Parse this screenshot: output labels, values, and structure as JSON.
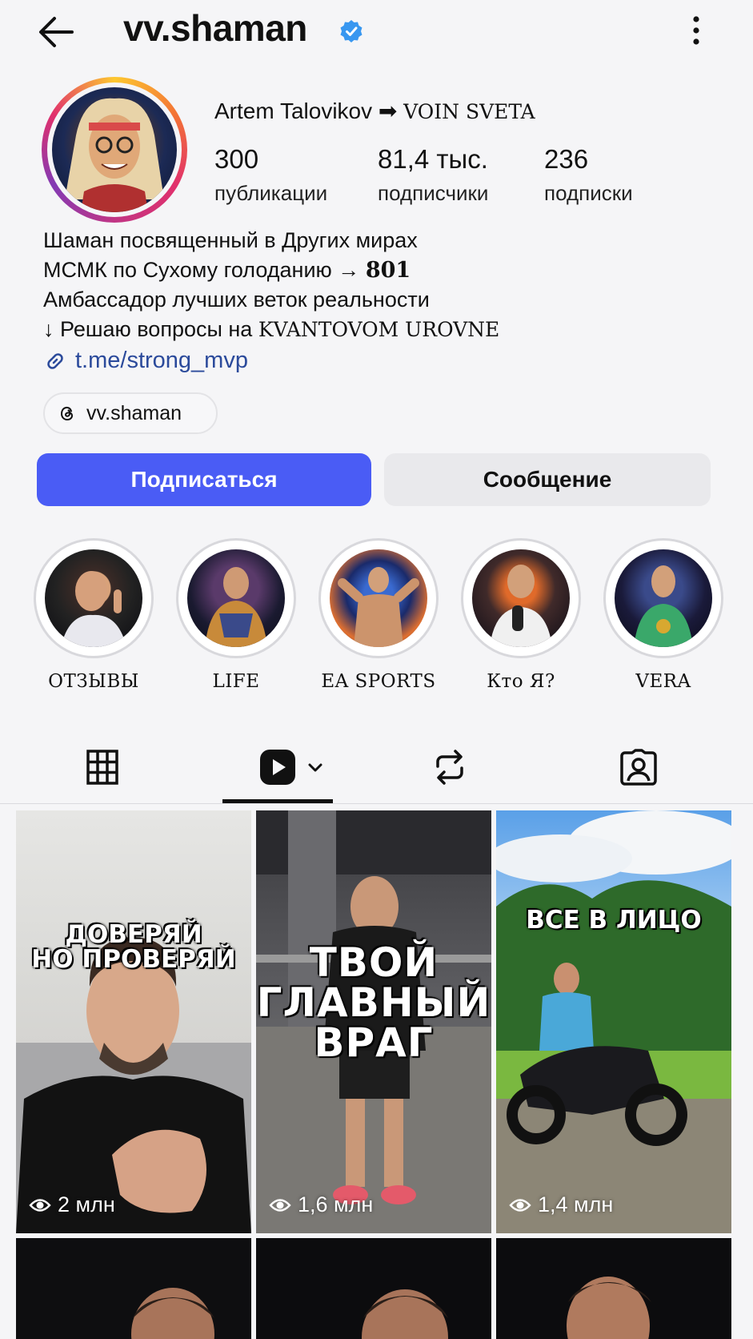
{
  "header": {
    "username": "vv.shaman",
    "back_icon": "arrow-left-icon",
    "more_icon": "more-vertical-icon",
    "verified_icon": "verified-badge-icon"
  },
  "profile": {
    "display_name_plain": "Artem Talovikov ➡ ",
    "display_name_styled": "VOIN SVETA",
    "stats": [
      {
        "value": "300",
        "label": "публикации"
      },
      {
        "value": "81,4 тыс.",
        "label": "подписчики"
      },
      {
        "value": "236",
        "label": "подписки"
      }
    ],
    "bio": {
      "line1": "Шаман посвященный в Других мирах",
      "line2_text": "МСМК по Сухому голоданию → ",
      "line2_num": "801",
      "line3": "Амбассадор лучших веток реальности",
      "line4_text": "↓ Решаю вопросы на ",
      "line4_styled": "KVANTOVOM UROVNE"
    },
    "link": "t.me/strong_mvp",
    "threads_handle": "vv.shaman"
  },
  "actions": {
    "follow": "Подписаться",
    "message": "Сообщение"
  },
  "highlights": [
    {
      "label": "ОТЗЫВЫ"
    },
    {
      "label": "LIFE"
    },
    {
      "label": "EA SPORTS"
    },
    {
      "label": "Кто Я?"
    },
    {
      "label": "VERA"
    }
  ],
  "tabs": {
    "grid_icon": "grid-icon",
    "reels_icon": "reels-icon",
    "reposts_icon": "repost-icon",
    "tagged_icon": "tagged-person-icon",
    "active": "reels"
  },
  "reels": [
    {
      "caption": "ДОВЕРЯЙ\nНО ПРОВЕРЯЙ",
      "views": "2 млн"
    },
    {
      "caption": "ТВОЙ\nГЛАВНЫЙ\nВРАГ",
      "views": "1,6 млн"
    },
    {
      "caption": "ВСЕ В ЛИЦО",
      "views": "1,4 млн"
    }
  ],
  "colors": {
    "follow_button": "#4a5cf5",
    "link": "#2b4a9b",
    "verified": "#3897f0"
  }
}
